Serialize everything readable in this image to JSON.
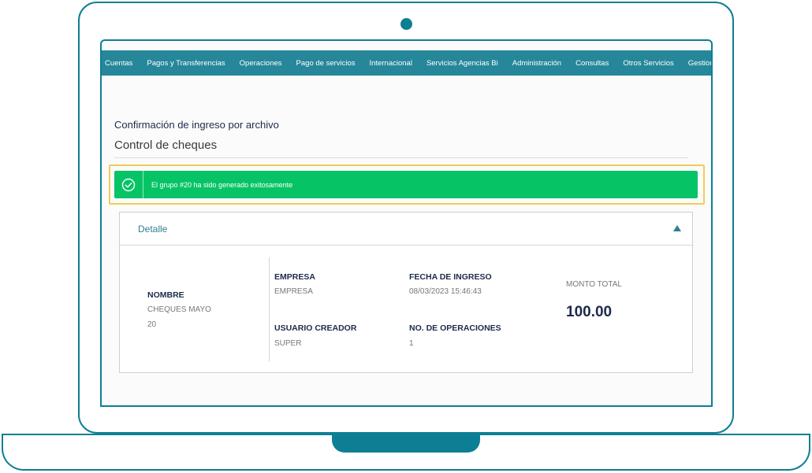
{
  "nav": {
    "items": [
      "Cuentas",
      "Pagos y Transferencias",
      "Operaciones",
      "Pago de servicios",
      "Internacional",
      "Servicios Agencias Bi",
      "Administración",
      "Consultas",
      "Otros Servicios",
      "Gestiones"
    ]
  },
  "page": {
    "title": "Confirmación de ingreso por archivo",
    "subtitle": "Control de cheques"
  },
  "alert": {
    "message": "El grupo #20 ha sido generado exitosamente",
    "icon": "check-circle-icon",
    "color": "#06c466"
  },
  "detail": {
    "title": "Detalle",
    "nombre_label": "NOMBRE",
    "nombre_value": "CHEQUES MAYO",
    "nombre_id": "20",
    "empresa_label": "EMPRESA",
    "empresa_value": "EMPRESA",
    "usuario_label": "USUARIO CREADOR",
    "usuario_value": "SUPER",
    "fecha_label": "FECHA DE INGRESO",
    "fecha_value": "08/03/2023 15:46:43",
    "operaciones_label": "NO. DE OPERACIONES",
    "operaciones_value": "1",
    "monto_label": "MONTO TOTAL",
    "monto_value": "100.00"
  },
  "colors": {
    "frame": "#0d7f94",
    "navbar": "#26879a",
    "highlight": "#f2cc55"
  }
}
